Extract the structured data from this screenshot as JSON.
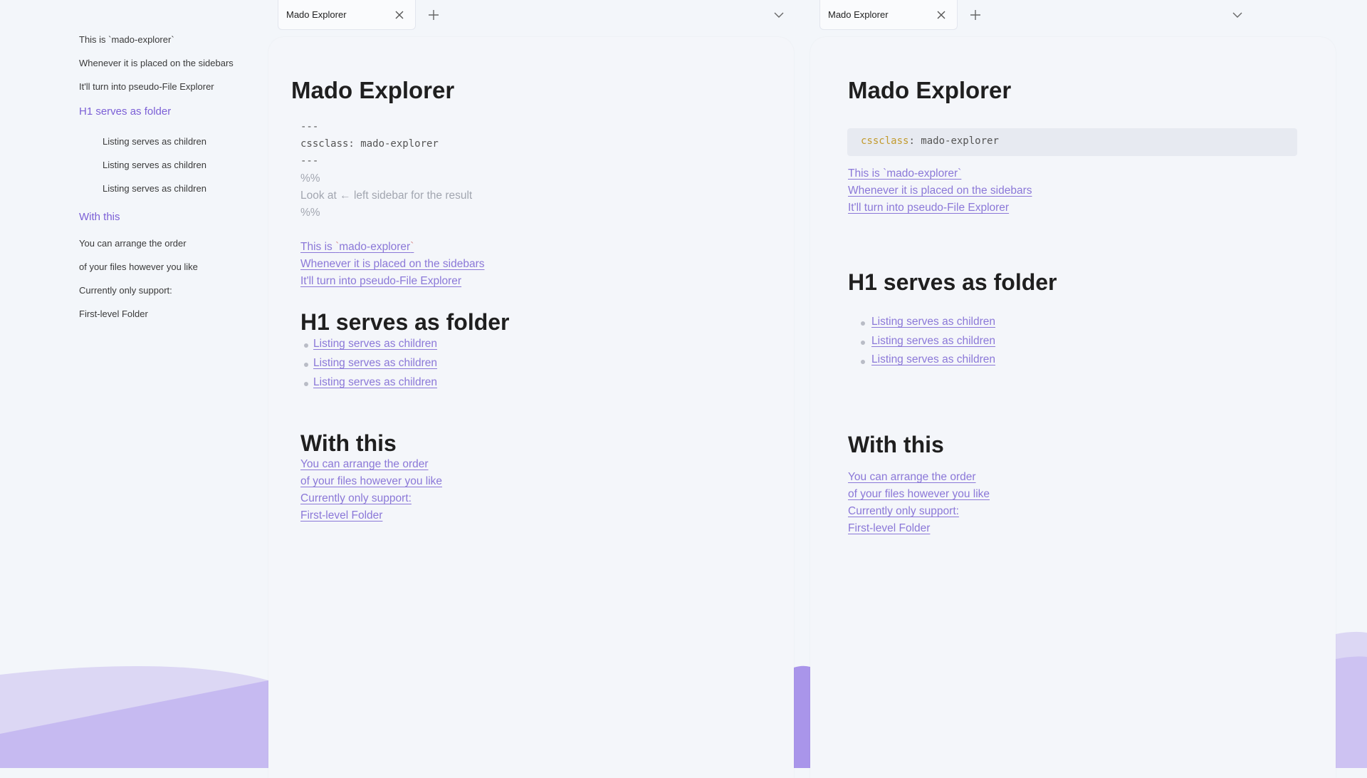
{
  "colors": {
    "accent": "#7c60d6",
    "link": "#8b78d8",
    "background": "#f3f6fa",
    "wave_light": "#dbd6f3",
    "wave_mid": "#c4b8f0",
    "wave_dark": "#ab97ea",
    "code_key": "#c29a2d"
  },
  "outline": {
    "items": [
      {
        "text": "This is `mado-explorer`",
        "level": "line"
      },
      {
        "text": "Whenever it is placed on the sidebars",
        "level": "line"
      },
      {
        "text": "It'll turn into pseudo-File Explorer",
        "level": "line"
      },
      {
        "text": "H1 serves as folder",
        "level": "heading"
      },
      {
        "text": "Listing serves as children",
        "level": "child"
      },
      {
        "text": "Listing serves as children",
        "level": "child"
      },
      {
        "text": "Listing serves as children",
        "level": "child"
      },
      {
        "text": "With this",
        "level": "heading"
      },
      {
        "text": "You can arrange the order",
        "level": "line"
      },
      {
        "text": "of your files however you like",
        "level": "line"
      },
      {
        "text": "Currently only support:",
        "level": "line"
      },
      {
        "text": "First-level Folder",
        "level": "line"
      }
    ]
  },
  "tabs": {
    "left": {
      "title": "Mado Explorer",
      "close_icon": "close-icon",
      "new_tab_icon": "plus-icon",
      "menu_icon": "chevron-down-icon"
    },
    "right": {
      "title": "Mado Explorer",
      "close_icon": "close-icon",
      "new_tab_icon": "plus-icon",
      "menu_icon": "chevron-down-icon"
    }
  },
  "editor": {
    "title": "Mado Explorer",
    "frontmatter": [
      "---",
      "cssclass: mado-explorer",
      "---"
    ],
    "comment": [
      "%%",
      "Look at ← left sidebar for the result",
      "%%"
    ],
    "intro_links": {
      "line1_prefix": "This is ",
      "line1_tick_open": "`",
      "line1_code": "mado-explorer",
      "line1_tick_close": "`",
      "line2": "Whenever it is placed on the sidebars",
      "line3": "It'll turn into pseudo-File Explorer"
    },
    "folder_heading": "H1 serves as folder",
    "children": [
      "Listing serves as children",
      "Listing serves as children",
      "Listing serves as children"
    ],
    "with_heading": "With this",
    "with_links": [
      "You can arrange the order",
      "of your files however you like",
      "Currently only support:",
      "First-level Folder"
    ]
  },
  "preview": {
    "title": "Mado Explorer",
    "code": {
      "key": "cssclass",
      "sep": ": ",
      "value": "mado-explorer"
    },
    "intro_links": [
      "This is `mado-explorer`",
      "Whenever it is placed on the sidebars",
      "It'll turn into pseudo-File Explorer"
    ],
    "folder_heading": "H1 serves as folder",
    "children": [
      "Listing serves as children",
      "Listing serves as children",
      "Listing serves as children"
    ],
    "with_heading": "With this",
    "with_links": [
      "You can arrange the order",
      "of your files however you like",
      "Currently only support:",
      "First-level Folder"
    ]
  }
}
